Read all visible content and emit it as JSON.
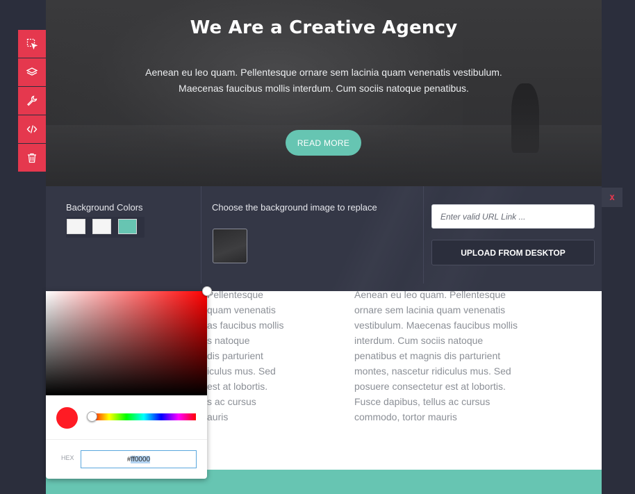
{
  "hero": {
    "title": "We Are a Creative Agency",
    "description_line1": "Aenean eu leo quam. Pellentesque ornare sem lacinia quam venenatis vestibulum.",
    "description_line2": "Maecenas faucibus mollis interdum. Cum sociis natoque penatibus.",
    "button_label": "READ MORE"
  },
  "toolbar": {
    "icons": [
      "select-icon",
      "layers-icon",
      "wrench-icon",
      "code-icon",
      "trash-icon"
    ]
  },
  "panel": {
    "bg_colors_label": "Background Colors",
    "swatches": [
      "#f5f5f5",
      "#f5f5f5",
      "#67c5b2"
    ],
    "bg_image_label": "Choose the background image to replace",
    "url_placeholder": "Enter valid URL Link ...",
    "upload_label": "UPLOAD FROM DESKTOP",
    "close_label": "x"
  },
  "content": {
    "col1_text": "Pellentesque\nquam venenatis\nas faucibus mollis\ns natoque\ndis parturient\niculus mus. Sed\nest at lobortis.\ns ac cursus\nauris",
    "col2_text": "Aenean eu leo quam. Pellentesque\nornare sem lacinia quam venenatis\nvestibulum. Maecenas faucibus mollis\ninterdum. Cum sociis natoque\npenatibus et magnis dis parturient\nmontes, nascetur ridiculus mus. Sed\nposuere consectetur est at lobortis.\nFusce dapibus, tellus ac cursus\ncommodo, tortor mauris"
  },
  "color_picker": {
    "hex_label": "HEX",
    "hex_prefix": "#",
    "hex_selected": "ff0000",
    "preview_color": "#ff1b24"
  },
  "colors": {
    "accent_red": "#e5384e",
    "teal": "#67c5b2",
    "panel_bg": "#343746",
    "page_bg": "#2b2e3c"
  }
}
